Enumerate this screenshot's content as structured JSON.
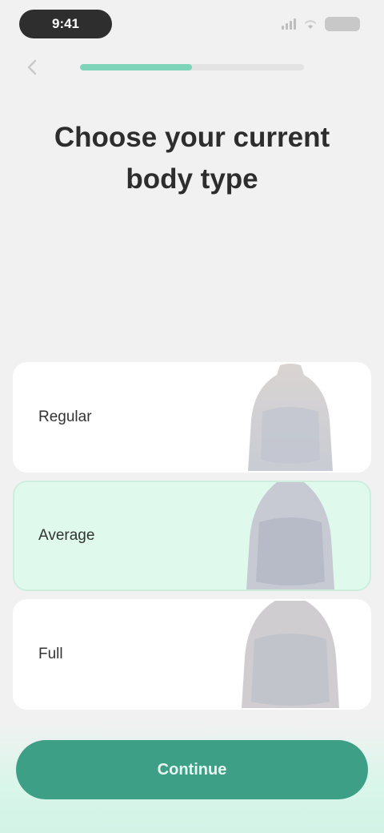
{
  "status_bar": {
    "time": "9:41",
    "icons": [
      "signal-icon",
      "wifi-icon",
      "battery-icon"
    ]
  },
  "header": {
    "back_icon": "chevron-left-icon",
    "progress_fraction": 0.5
  },
  "title": "Choose your current body type",
  "options": [
    {
      "label": "Regular",
      "selected": false,
      "image_icon": "body-silhouette-icon"
    },
    {
      "label": "Average",
      "selected": true,
      "image_icon": "body-silhouette-icon"
    },
    {
      "label": "Full",
      "selected": false,
      "image_icon": "body-silhouette-icon"
    }
  ],
  "continue": {
    "label": "Continue"
  },
  "colors": {
    "accent": "#3d9f86",
    "progress": "#7dd4b8",
    "selected_bg": "#dffaec",
    "background": "#f1f1f1"
  }
}
